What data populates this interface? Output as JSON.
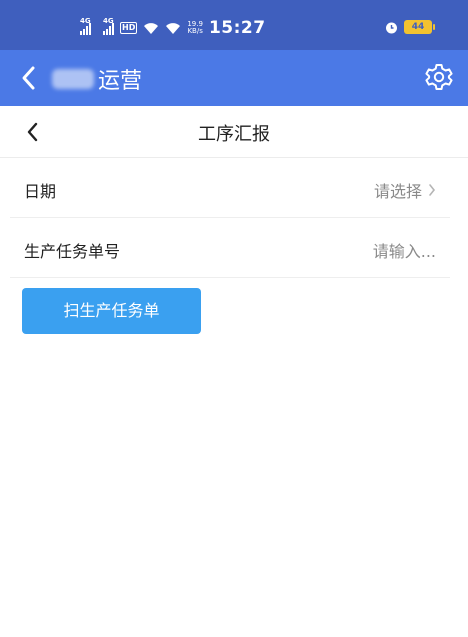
{
  "status_bar": {
    "network_1": "4G",
    "network_2": "4G",
    "hd_badge": "HD",
    "speed_value": "19.9",
    "speed_unit": "KB/s",
    "time": "15:27",
    "battery": "44"
  },
  "app_bar": {
    "title": "运营"
  },
  "page": {
    "title": "工序汇报"
  },
  "form": {
    "date": {
      "label": "日期",
      "placeholder": "请选择"
    },
    "task_no": {
      "label": "生产任务单号",
      "placeholder": "请输入..."
    }
  },
  "actions": {
    "scan_label": "扫生产任务单"
  }
}
